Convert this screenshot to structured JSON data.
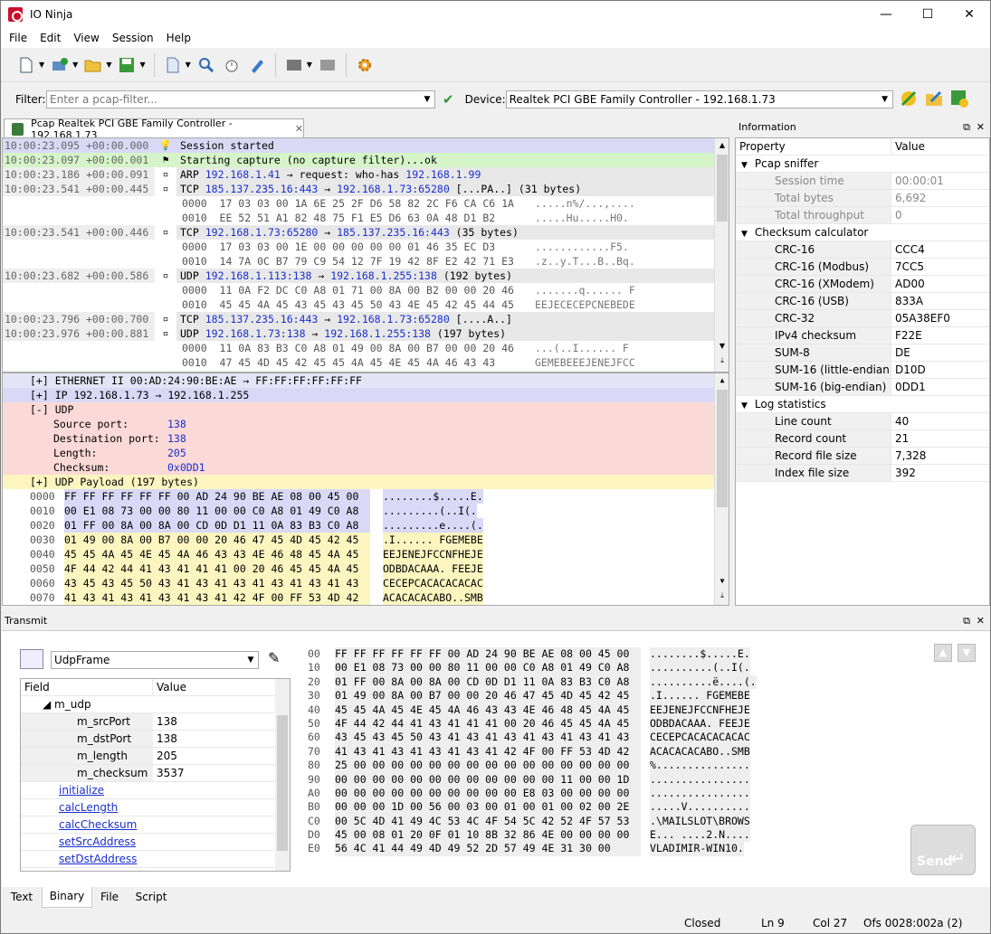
{
  "window": {
    "title": "IO Ninja"
  },
  "menu": [
    "File",
    "Edit",
    "View",
    "Session",
    "Help"
  ],
  "filter": {
    "label": "Filter:",
    "placeholder": "Enter a pcap-filter..."
  },
  "device": {
    "label": "Device:",
    "value": "Realtek PCI GBE Family Controller - 192.168.1.73"
  },
  "tab": {
    "label": "Pcap Realtek PCI GBE Family Controller - 192.168.1.73"
  },
  "log": [
    {
      "ts": "10:00:23.095 +00:00.000",
      "icon": "bulb-icon",
      "text": "Session started",
      "bg": "#d9d9f5"
    },
    {
      "ts": "10:00:23.097 +00:00.001",
      "icon": "capture-icon",
      "text": "Starting capture (no capture filter)...ok",
      "bg": "#d5f5c8"
    },
    {
      "ts": "10:00:23.186 +00:00.091",
      "icon": "packet-icon",
      "proto": "ARP",
      "a": "192.168.1.41",
      "mid": " → request: who-has ",
      "b": "192.168.1.99",
      "tail": "",
      "bg": "#e8e8e8"
    },
    {
      "ts": "10:00:23.541 +00:00.445",
      "icon": "packet-icon",
      "proto": "TCP",
      "a": "185.137.235.16:443",
      "mid": " → ",
      "b": "192.168.1.73:65280",
      "tail": " [...PA..] (31 bytes)",
      "bg": "#e8e8e8"
    },
    {
      "hex": "0000  17 03 03 00 1A 6E 25 2F D6 58 82 2C F6 CA C6 1A",
      "asc": ".....n%/...,...."
    },
    {
      "hex": "0010  EE 52 51 A1 82 48 75 F1 E5 D6 63 0A 48 D1 B2",
      "asc": ".....Hu.....H0."
    },
    {
      "ts": "10:00:23.541 +00:00.446",
      "icon": "packet-icon",
      "proto": "TCP",
      "a": "192.168.1.73:65280",
      "mid": " → ",
      "b": "185.137.235.16:443",
      "tail": " (35 bytes)",
      "bg": "#e8e8e8"
    },
    {
      "hex": "0000  17 03 03 00 1E 00 00 00 00 00 01 46 35 EC D3",
      "asc": "............F5."
    },
    {
      "hex": "0010  14 7A 0C B7 79 C9 54 12 7F 19 42 8F E2 42 71 E3",
      "asc": ".z..y.T...B..Bq."
    },
    {
      "ts": "10:00:23.682 +00:00.586",
      "icon": "packet-icon",
      "proto": "UDP",
      "a": "192.168.1.113:138",
      "mid": " → ",
      "b": "192.168.1.255:138",
      "tail": " (192 bytes)",
      "bg": "#e8e8e8"
    },
    {
      "hex": "0000  11 0A F2 DC C0 A8 01 71 00 8A 00 B2 00 00 20 46",
      "asc": ".......q...... F"
    },
    {
      "hex": "0010  45 45 4A 45 43 45 43 45 50 43 4E 45 42 45 44 45",
      "asc": "EEJECECEPCNEBEDE"
    },
    {
      "ts": "10:00:23.796 +00:00.700",
      "icon": "packet-icon",
      "proto": "TCP",
      "a": "185.137.235.16:443",
      "mid": " → ",
      "b": "192.168.1.73:65280",
      "tail": " [....A..]",
      "bg": "#e8e8e8"
    },
    {
      "ts": "10:00:23.976 +00:00.881",
      "icon": "packet-icon",
      "proto": "UDP",
      "a": "192.168.1.73:138",
      "mid": " → ",
      "b": "192.168.1.255:138",
      "tail": " (197 bytes)",
      "bg": "#e8e8e8"
    },
    {
      "hex": "0000  11 0A 83 B3 C0 A8 01 49 00 8A 00 B7 00 00 20 46",
      "asc": "...(..I...... F"
    },
    {
      "hex": "0010  47 45 4D 45 42 45 45 4A 45 4E 45 4A 46 43 43",
      "asc": "GEMEBEEEJENEJFCC"
    }
  ],
  "packet": {
    "eth": "[+] ETHERNET II 00:AD:24:90:BE:AE → FF:FF:FF:FF:FF:FF",
    "ip": "[+] IP 192.168.1.73 → 192.168.1.255",
    "udp": "[-] UDP",
    "fields": [
      {
        "k": "Source port:",
        "v": "138"
      },
      {
        "k": "Destination port:",
        "v": "138"
      },
      {
        "k": "Length:",
        "v": "205"
      },
      {
        "k": "Checksum:",
        "v": "0x0DD1"
      }
    ],
    "payload": "[+] UDP Payload (197 bytes)",
    "hex": [
      {
        "o": "0000",
        "h": "FF FF FF FF FF FF 00 AD 24 90 BE AE 08 00 45 00",
        "a": "........$.....E."
      },
      {
        "o": "0010",
        "h": "00 E1 08 73 00 00 80 11 00 00 C0 A8 01 49 C0 A8",
        "a": ".........(..I(."
      },
      {
        "o": "0020",
        "h": "01 FF 00 8A 00 8A 00 CD 0D D1 11 0A 83 B3 C0 A8",
        "a": ".........e....(."
      },
      {
        "o": "0030",
        "h": "01 49 00 8A 00 B7 00 00 20 46 47 45 4D 45 42 45",
        "a": ".I...... FGEMEBE"
      },
      {
        "o": "0040",
        "h": "45 45 4A 45 4E 45 4A 46 43 43 4E 46 48 45 4A 45",
        "a": "EEJENEJFCCNFHEJE"
      },
      {
        "o": "0050",
        "h": "4F 44 42 44 41 43 41 41 41 00 20 46 45 45 4A 45",
        "a": "ODBDACAAA. FEEJE"
      },
      {
        "o": "0060",
        "h": "43 45 43 45 50 43 41 43 41 43 41 43 41 43 41 43",
        "a": "CECEPCACACACACAC"
      },
      {
        "o": "0070",
        "h": "41 43 41 43 41 43 41 43 41 42 4F 00 FF 53 4D 42",
        "a": "ACACACACABO..SMB"
      }
    ]
  },
  "info": {
    "title": "Information",
    "headers": [
      "Property",
      "Value"
    ],
    "sections": [
      {
        "name": "Pcap sniffer",
        "rows": [
          {
            "k": "Session time",
            "v": "00:00:01",
            "dim": true
          },
          {
            "k": "Total bytes",
            "v": "6,692",
            "dim": true
          },
          {
            "k": "Total throughput",
            "v": "0",
            "dim": true
          }
        ]
      },
      {
        "name": "Checksum calculator",
        "rows": [
          {
            "k": "CRC-16",
            "v": "CCC4"
          },
          {
            "k": "CRC-16 (Modbus)",
            "v": "7CC5"
          },
          {
            "k": "CRC-16 (XModem)",
            "v": "AD00"
          },
          {
            "k": "CRC-16 (USB)",
            "v": "833A"
          },
          {
            "k": "CRC-32",
            "v": "05A38EF0"
          },
          {
            "k": "IPv4 checksum",
            "v": "F22E"
          },
          {
            "k": "SUM-8",
            "v": "DE"
          },
          {
            "k": "SUM-16 (little-endian)",
            "v": "D10D"
          },
          {
            "k": "SUM-16 (big-endian)",
            "v": "0DD1"
          }
        ]
      },
      {
        "name": "Log statistics",
        "rows": [
          {
            "k": "Line count",
            "v": "40"
          },
          {
            "k": "Record count",
            "v": "21"
          },
          {
            "k": "Record file size",
            "v": "7,328"
          },
          {
            "k": "Index file size",
            "v": "392"
          }
        ]
      }
    ]
  },
  "transmit": {
    "title": "Transmit",
    "frame": "UdpFrame",
    "headers": [
      "Field",
      "Value"
    ],
    "group": "m_udp",
    "fields": [
      {
        "k": "m_srcPort",
        "v": "138"
      },
      {
        "k": "m_dstPort",
        "v": "138"
      },
      {
        "k": "m_length",
        "v": "205"
      },
      {
        "k": "m_checksum",
        "v": "3537"
      }
    ],
    "links": [
      "initialize",
      "calcLength",
      "calcChecksum",
      "setSrcAddress",
      "setDstAddress"
    ],
    "hex": [
      {
        "o": "00",
        "h": "FF FF FF FF FF FF 00 AD 24 90 BE AE 08 00 45 00",
        "a": "........$.....E."
      },
      {
        "o": "10",
        "h": "00 E1 08 73 00 00 80 11 00 00 C0 A8 01 49 C0 A8",
        "a": "..........(..I(."
      },
      {
        "o": "20",
        "h": "01 FF 00 8A 00 8A 00 CD 0D D1 11 0A 83 B3 C0 A8",
        "a": "..........ë....(."
      },
      {
        "o": "30",
        "h": "01 49 00 8A 00 B7 00 00 20 46 47 45 4D 45 42 45",
        "a": ".I...... FGEMEBE"
      },
      {
        "o": "40",
        "h": "45 45 4A 45 4E 45 4A 46 43 43 4E 46 48 45 4A 45",
        "a": "EEJENEJFCCNFHEJE"
      },
      {
        "o": "50",
        "h": "4F 44 42 44 41 43 41 41 41 00 20 46 45 45 4A 45",
        "a": "ODBDACAAA. FEEJE"
      },
      {
        "o": "60",
        "h": "43 45 43 45 50 43 41 43 41 43 41 43 41 43 41 43",
        "a": "CECEPCACACACACAC"
      },
      {
        "o": "70",
        "h": "41 43 41 43 41 43 41 43 41 42 4F 00 FF 53 4D 42",
        "a": "ACACACACABO..SMB"
      },
      {
        "o": "80",
        "h": "25 00 00 00 00 00 00 00 00 00 00 00 00 00 00 00",
        "a": "%..............."
      },
      {
        "o": "90",
        "h": "00 00 00 00 00 00 00 00 00 00 00 00 11 00 00 1D",
        "a": "................"
      },
      {
        "o": "A0",
        "h": "00 00 00 00 00 00 00 00 00 00 E8 03 00 00 00 00",
        "a": "................"
      },
      {
        "o": "B0",
        "h": "00 00 00 1D 00 56 00 03 00 01 00 01 00 02 00 2E",
        "a": ".....V.........."
      },
      {
        "o": "C0",
        "h": "00 5C 4D 41 49 4C 53 4C 4F 54 5C 42 52 4F 57 53",
        "a": ".\\MAILSLOT\\BROWS"
      },
      {
        "o": "D0",
        "h": "45 00 08 01 20 0F 01 10 8B 32 86 4E 00 00 00 00",
        "a": "E... ....2.N...."
      },
      {
        "o": "E0",
        "h": "56 4C 41 44 49 4D 49 52 2D 57 49 4E 31 30 00",
        "a": "VLADIMIR-WIN10."
      }
    ],
    "send": "Send"
  },
  "bottom_tabs": [
    "Text",
    "Binary",
    "File",
    "Script"
  ],
  "status": {
    "state": "Closed",
    "ln": "Ln 9",
    "col": "Col 27",
    "ofs": "Ofs 0028:002a (2)"
  }
}
